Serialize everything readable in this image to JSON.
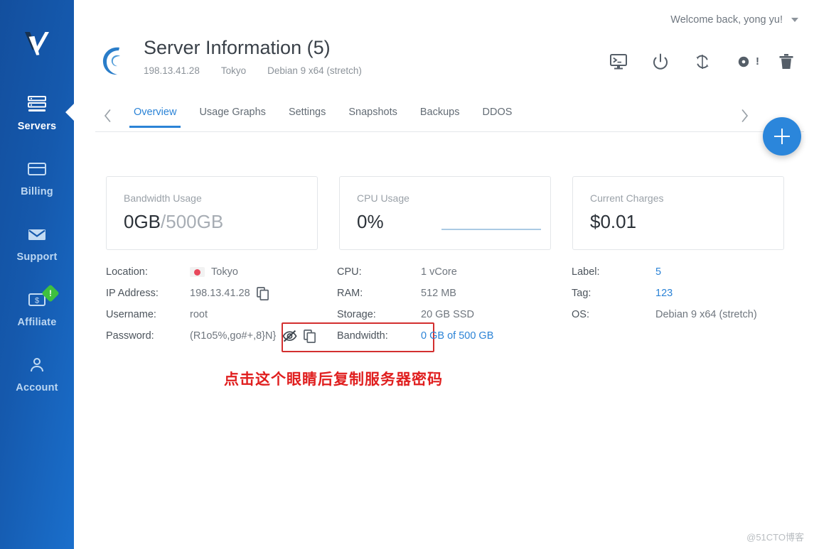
{
  "brand": {
    "logo_name": "vultr-logo",
    "sidebar_gradient_from": "#134f9e",
    "sidebar_gradient_to": "#1a6fcc",
    "accent": "#2b83d6",
    "alert_red": "#e01f1f"
  },
  "sidebar": {
    "items": [
      {
        "label": "Servers",
        "icon": "servers-icon",
        "active": true,
        "badge": null
      },
      {
        "label": "Billing",
        "icon": "billing-icon",
        "active": false,
        "badge": null
      },
      {
        "label": "Support",
        "icon": "support-icon",
        "active": false,
        "badge": null
      },
      {
        "label": "Affiliate",
        "icon": "affiliate-icon",
        "active": false,
        "badge": "!"
      },
      {
        "label": "Account",
        "icon": "account-icon",
        "active": false,
        "badge": null
      }
    ]
  },
  "topbar": {
    "welcome": "Welcome back, yong yu!",
    "caret_icon": "chevron-down-icon"
  },
  "header": {
    "os_logo_icon": "debian-logo-icon",
    "title": "Server Information (5)",
    "meta": {
      "ip": "198.13.41.28",
      "location": "Tokyo",
      "os": "Debian 9 x64 (stretch)"
    },
    "actions": [
      {
        "name": "console-icon",
        "title": "Console"
      },
      {
        "name": "power-icon",
        "title": "Power"
      },
      {
        "name": "restart-icon",
        "title": "Restart"
      },
      {
        "name": "reinstall-icon",
        "title": "Reinstall",
        "suffix": "!"
      },
      {
        "name": "trash-icon",
        "title": "Destroy"
      }
    ]
  },
  "tabs": {
    "prev_icon": "chevron-left-icon",
    "next_icon": "chevron-right-icon",
    "items": [
      {
        "label": "Overview",
        "active": true
      },
      {
        "label": "Usage Graphs",
        "active": false
      },
      {
        "label": "Settings",
        "active": false
      },
      {
        "label": "Snapshots",
        "active": false
      },
      {
        "label": "Backups",
        "active": false
      },
      {
        "label": "DDOS",
        "active": false
      }
    ]
  },
  "fab": {
    "icon": "plus-icon",
    "label": "+"
  },
  "cards": [
    {
      "label": "Bandwidth Usage",
      "value": "0GB",
      "suffix": "/500GB",
      "spark": false
    },
    {
      "label": "CPU Usage",
      "value": "0%",
      "suffix": "",
      "spark": true
    },
    {
      "label": "Current Charges",
      "value": "$0.01",
      "suffix": "",
      "spark": false
    }
  ],
  "details": {
    "column1": [
      {
        "key": "Location:",
        "value": "Tokyo",
        "flag": true,
        "link": false,
        "copy": false,
        "eye": false
      },
      {
        "key": "IP Address:",
        "value": "198.13.41.28",
        "flag": false,
        "link": false,
        "copy": true,
        "eye": false
      },
      {
        "key": "Username:",
        "value": "root",
        "flag": false,
        "link": false,
        "copy": false,
        "eye": false
      },
      {
        "key": "Password:",
        "value": "(R1o5%,go#+,8}N}",
        "flag": false,
        "link": false,
        "copy": true,
        "eye": true
      }
    ],
    "column2": [
      {
        "key": "CPU:",
        "value": "1 vCore",
        "link": false
      },
      {
        "key": "RAM:",
        "value": "512 MB",
        "link": false
      },
      {
        "key": "Storage:",
        "value": "20 GB SSD",
        "link": false
      },
      {
        "key": "Bandwidth:",
        "value": "0 GB of 500 GB",
        "link": true
      }
    ],
    "column3": [
      {
        "key": "Label:",
        "value": "5",
        "link": true
      },
      {
        "key": "Tag:",
        "value": "123",
        "link": true
      },
      {
        "key": "OS:",
        "value": "Debian 9 x64 (stretch)",
        "link": false
      }
    ]
  },
  "annotation": "点击这个眼睛后复制服务器密码",
  "watermark": "@51CTO博客"
}
